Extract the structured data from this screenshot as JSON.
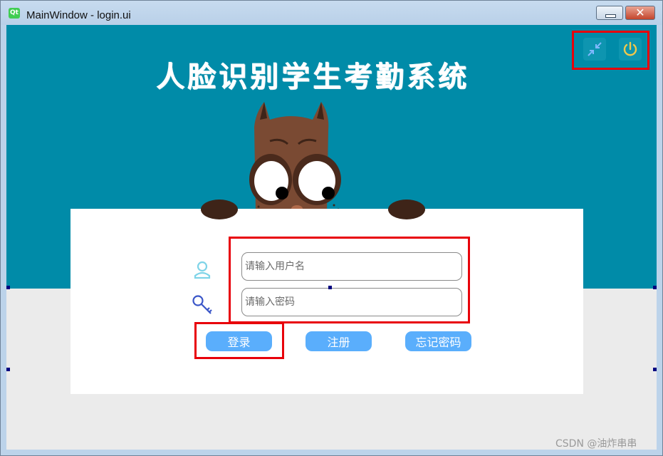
{
  "window": {
    "title": "MainWindow - login.ui"
  },
  "app": {
    "title": "人脸识别学生考勤系统"
  },
  "login": {
    "username_placeholder": "请输入用户名",
    "password_placeholder": "请输入密码",
    "login_label": "登录",
    "register_label": "注册",
    "forgot_label": "忘记密码"
  },
  "colors": {
    "teal_background": "#008ba8",
    "button_blue": "#5aaefc",
    "highlight_red": "#e8000a",
    "owl_brown": "#7a4a33"
  },
  "icons": {
    "minimize": "shrink-arrows-icon",
    "power": "power-icon",
    "user": "user-icon",
    "password": "key-icon"
  },
  "watermark": "CSDN @油炸串串"
}
